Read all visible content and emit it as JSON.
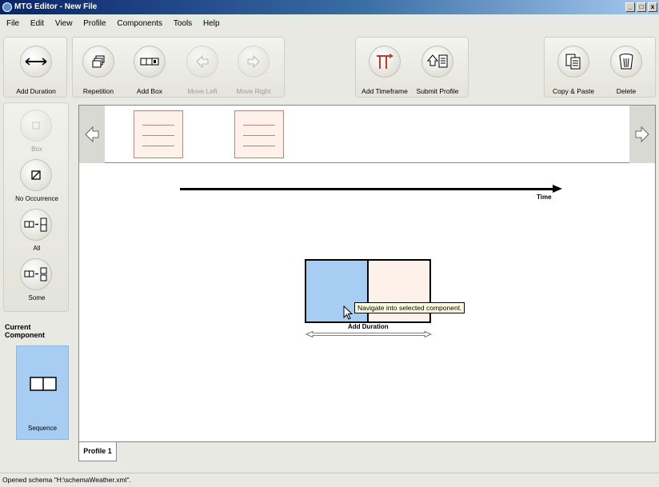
{
  "window": {
    "title": "MTG Editor - New File",
    "controls": [
      "_",
      "□",
      "x"
    ]
  },
  "menu": [
    "File",
    "Edit",
    "View",
    "Profile",
    "Components",
    "Tools",
    "Help"
  ],
  "toolbar": {
    "add_duration": "Add Duration",
    "repetition": "Repetition",
    "add_box": "Add Box",
    "move_left": "Move Left",
    "move_right": "Move Right",
    "add_timeframe": "Add Timeframe",
    "submit_profile": "Submit Profile",
    "copy_paste": "Copy & Paste",
    "delete": "Delete"
  },
  "palette": {
    "box": "Box",
    "no_occurrence": "No Occurrence",
    "all": "All",
    "some": "Some"
  },
  "current_component": {
    "title": "Current Component",
    "type": "Sequence",
    "color": "#a7cdf3"
  },
  "canvas": {
    "time_label": "Time",
    "duration_label": "Add Duration",
    "tooltip": "Navigate into selected component.",
    "selected_color": "#a7cdf3",
    "unselected_color": "#fdf1ea"
  },
  "tabs": [
    "Profile 1"
  ],
  "status": "Opened schema \"H:\\schemaWeather.xml\"."
}
